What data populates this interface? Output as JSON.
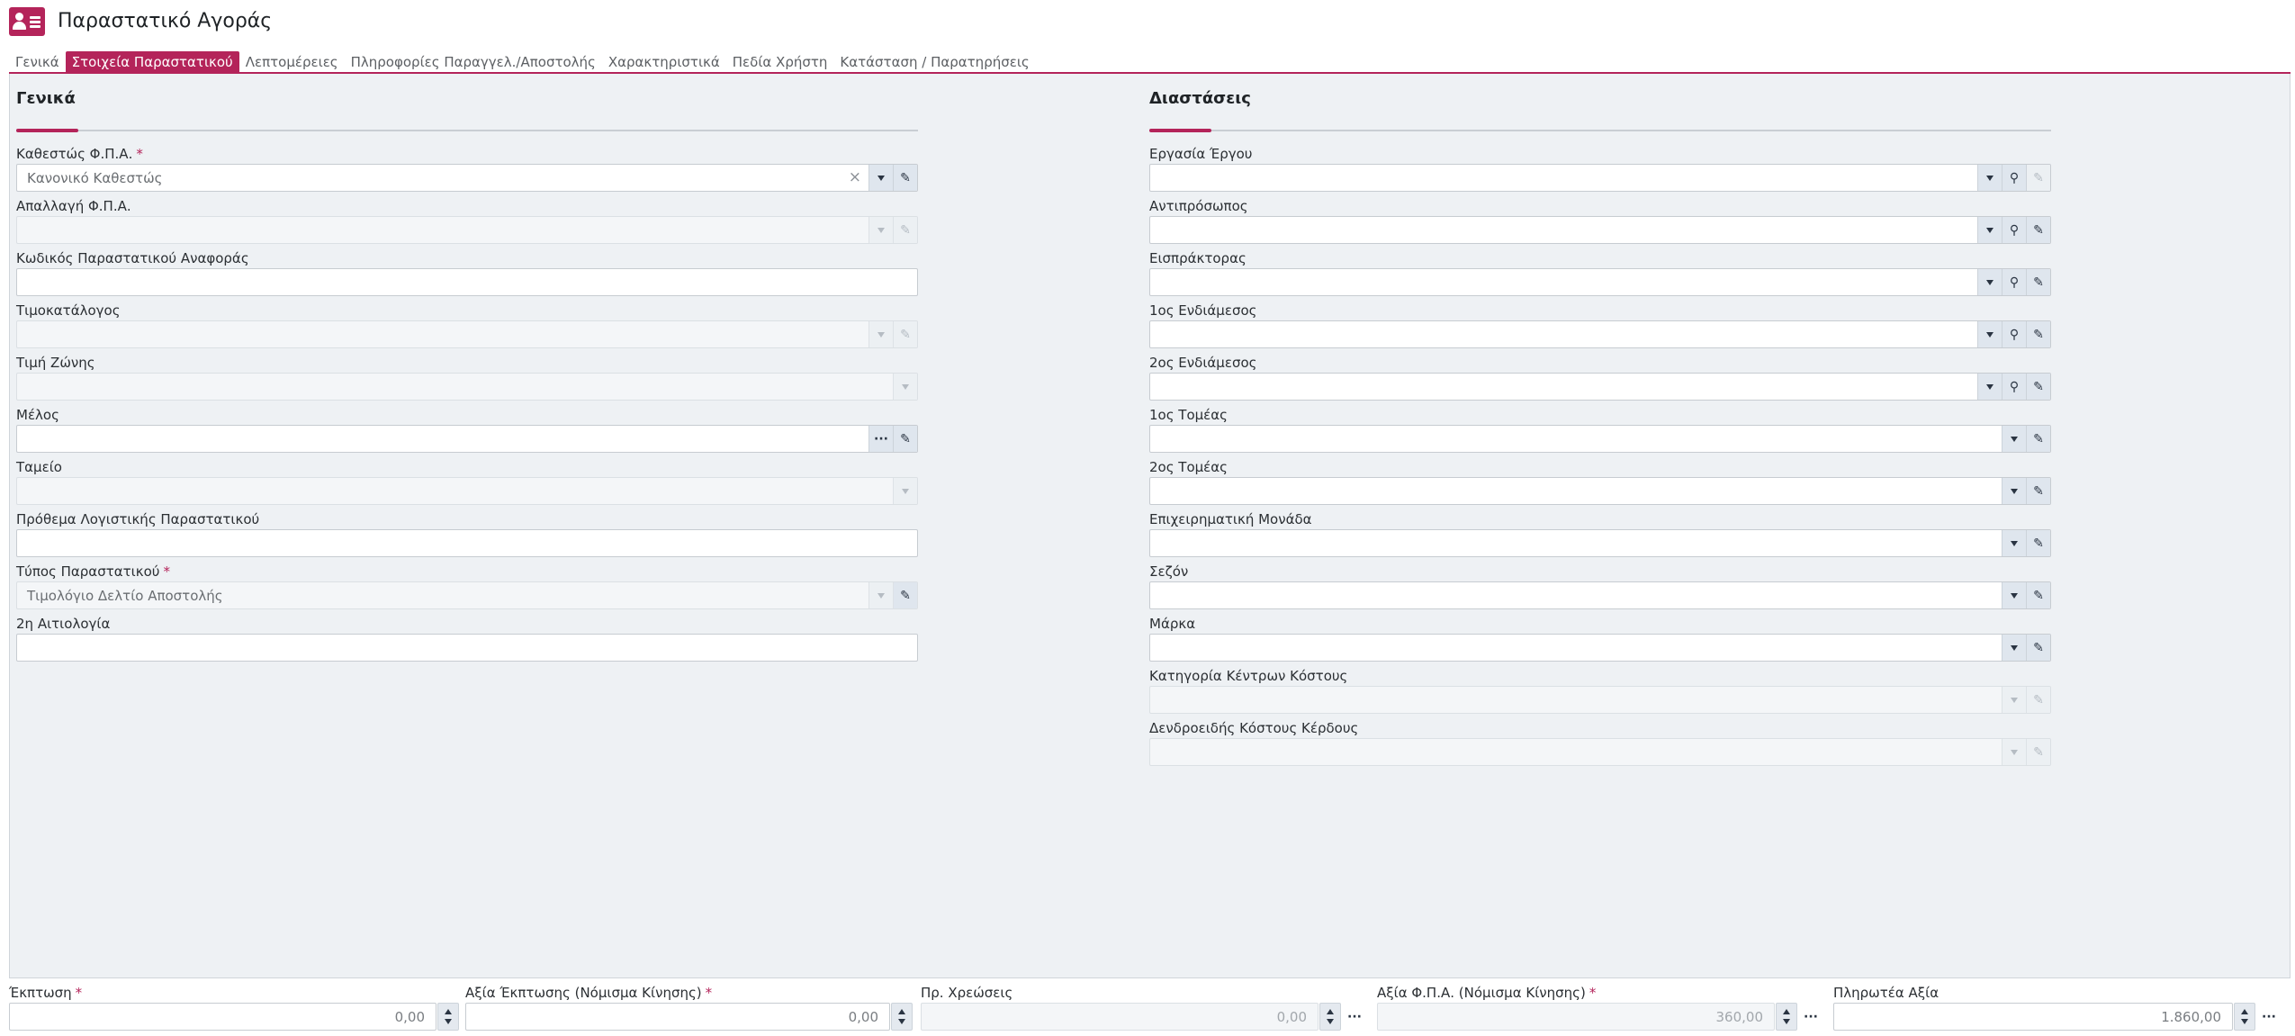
{
  "header": {
    "title": "Παραστατικό Αγοράς",
    "icon": "contact-card-icon",
    "accent": "#b4245a"
  },
  "tabs": [
    {
      "label": "Γενικά",
      "active": false
    },
    {
      "label": "Στοιχεία Παραστατικού",
      "active": true
    },
    {
      "label": "Λεπτομέρειες",
      "active": false
    },
    {
      "label": "Πληροφορίες Παραγγελ./Αποστολής",
      "active": false
    },
    {
      "label": "Χαρακτηριστικά",
      "active": false
    },
    {
      "label": "Πεδία Χρήστη",
      "active": false
    },
    {
      "label": "Κατάσταση / Παρατηρήσεις",
      "active": false
    }
  ],
  "general": {
    "title": "Γενικά",
    "fields": [
      {
        "label": "Καθεστώς Φ.Π.Α.",
        "required": true,
        "value": "Κανονικό Καθεστώς",
        "disabled": false
      },
      {
        "label": "Απαλλαγή Φ.Π.Α.",
        "required": false,
        "value": "",
        "disabled": true
      },
      {
        "label": "Κωδικός Παραστατικού Αναφοράς",
        "required": false,
        "value": "",
        "disabled": false
      },
      {
        "label": "Τιμοκατάλογος",
        "required": false,
        "value": "",
        "disabled": true
      },
      {
        "label": "Τιμή Ζώνης",
        "required": false,
        "value": "",
        "disabled": true
      },
      {
        "label": "Μέλος",
        "required": false,
        "value": "",
        "disabled": false
      },
      {
        "label": "Ταμείο",
        "required": false,
        "value": "",
        "disabled": true
      },
      {
        "label": "Πρόθεμα Λογιστικής Παραστατικού",
        "required": false,
        "value": "",
        "disabled": false
      },
      {
        "label": "Τύπος Παραστατικού",
        "required": true,
        "value": "Τιμολόγιο Δελτίο Αποστολής",
        "disabled": true
      },
      {
        "label": "2η Αιτιολογία",
        "required": false,
        "value": "",
        "disabled": false
      }
    ]
  },
  "dimensions": {
    "title": "Διαστάσεις",
    "fields": [
      {
        "label": "Εργασία Έργου",
        "value": "",
        "disabled": false
      },
      {
        "label": "Αντιπρόσωπος",
        "value": "",
        "disabled": false
      },
      {
        "label": "Εισπράκτορας",
        "value": "",
        "disabled": false
      },
      {
        "label": "1ος Ενδιάμεσος",
        "value": "",
        "disabled": false
      },
      {
        "label": "2ος Ενδιάμεσος",
        "value": "",
        "disabled": false
      },
      {
        "label": "1ος Τομέας",
        "value": "",
        "disabled": false
      },
      {
        "label": "2ος Τομέας",
        "value": "",
        "disabled": false
      },
      {
        "label": "Επιχειρηματική Μονάδα",
        "value": "",
        "disabled": false
      },
      {
        "label": "Σεζόν",
        "value": "",
        "disabled": false
      },
      {
        "label": "Μάρκα",
        "value": "",
        "disabled": false
      },
      {
        "label": "Κατηγορία Κέντρων Κόστους",
        "value": "",
        "disabled": true
      },
      {
        "label": "Δενδροειδής Κόστους Κέρδους",
        "value": "",
        "disabled": true
      }
    ]
  },
  "totals": [
    {
      "label": "Έκπτωση",
      "required": true,
      "value": "0,00",
      "disabled": false
    },
    {
      "label": "Αξία Έκπτωσης (Νόμισμα Κίνησης)",
      "required": true,
      "value": "0,00",
      "disabled": false
    },
    {
      "label": "Πρ. Χρεώσεις",
      "required": false,
      "value": "0,00",
      "disabled": true
    },
    {
      "label": "Αξία Φ.Π.Α. (Νόμισμα Κίνησης)",
      "required": true,
      "value": "360,00",
      "disabled": true
    },
    {
      "label": "Πληρωτέα Αξία",
      "required": false,
      "value": "1.860,00",
      "disabled": false
    }
  ]
}
